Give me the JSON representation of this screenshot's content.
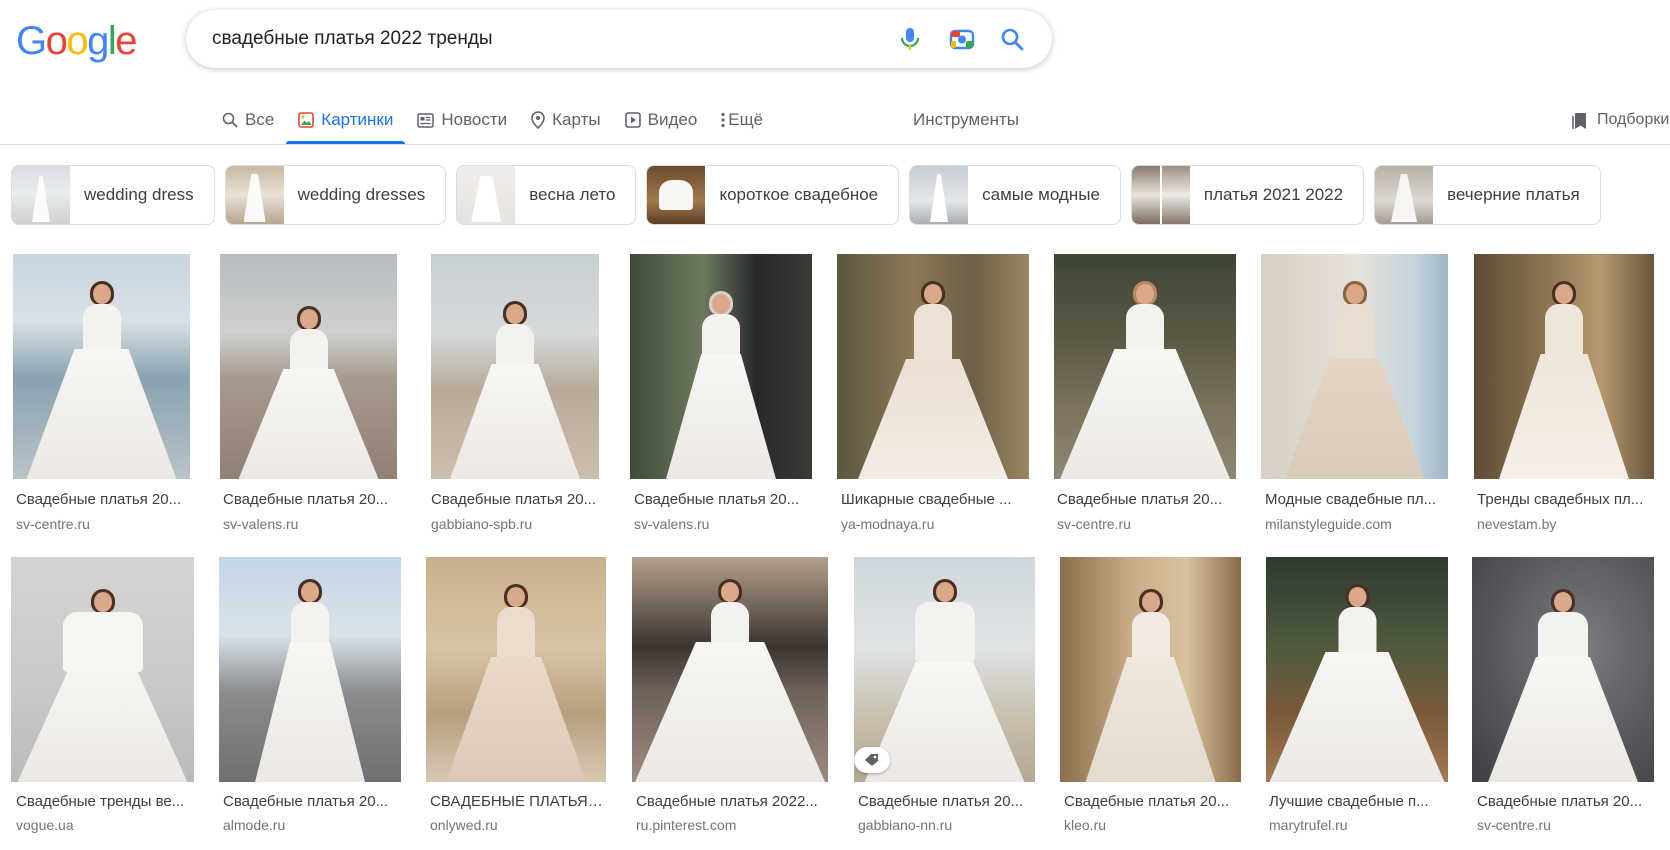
{
  "logo": {
    "text": "Google",
    "letters": [
      "G",
      "o",
      "o",
      "g",
      "l",
      "e"
    ],
    "colors": [
      "#4285F4",
      "#EA4335",
      "#FBBC05",
      "#4285F4",
      "#34A853",
      "#EA4335"
    ]
  },
  "search": {
    "query": "свадебные платья 2022 тренды"
  },
  "tabs": [
    {
      "label": "Все",
      "icon": "search-icon",
      "active": false
    },
    {
      "label": "Картинки",
      "icon": "image-icon",
      "active": true
    },
    {
      "label": "Новости",
      "icon": "news-icon",
      "active": false
    },
    {
      "label": "Карты",
      "icon": "map-pin-icon",
      "active": false
    },
    {
      "label": "Видео",
      "icon": "video-icon",
      "active": false
    },
    {
      "label": "Ещё",
      "icon": "more-vert-icon",
      "active": false
    }
  ],
  "tools_label": "Инструменты",
  "collections_label": "Подборки",
  "chips": [
    {
      "label": "wedding dress"
    },
    {
      "label": "wedding dresses"
    },
    {
      "label": "весна лето"
    },
    {
      "label": "короткое свадебное"
    },
    {
      "label": "самые модные"
    },
    {
      "label": "платья 2021 2022"
    },
    {
      "label": "вечерние платья"
    }
  ],
  "results": [
    [
      {
        "title": "Свадебные платья 20...",
        "source": "sv-centre.ru"
      },
      {
        "title": "Свадебные платья 20...",
        "source": "sv-valens.ru"
      },
      {
        "title": "Свадебные платья 20...",
        "source": "gabbiano-spb.ru"
      },
      {
        "title": "Свадебные платья 20...",
        "source": "sv-valens.ru"
      },
      {
        "title": "Шикарные свадебные ...",
        "source": "ya-modnaya.ru"
      },
      {
        "title": "Свадебные платья 20...",
        "source": "sv-centre.ru"
      },
      {
        "title": "Модные свадебные пл...",
        "source": "milanstyleguide.com"
      },
      {
        "title": "Тренды свадебных пл...",
        "source": "nevestam.by"
      }
    ],
    [
      {
        "title": "Свадебные тренды ве...",
        "source": "vogue.ua"
      },
      {
        "title": "Свадебные платья 20...",
        "source": "almode.ru"
      },
      {
        "title": "СВАДЕБНЫЕ ПЛАТЬЯ ...",
        "source": "onlywed.ru"
      },
      {
        "title": "Свадебные платья 2022...",
        "source": "ru.pinterest.com"
      },
      {
        "title": "Свадебные платья 20...",
        "source": "gabbiano-nn.ru"
      },
      {
        "title": "Свадебные платья 20...",
        "source": "kleo.ru"
      },
      {
        "title": "Лучшие свадебные п...",
        "source": "marytrufel.ru"
      },
      {
        "title": "Свадебные платья 20...",
        "source": "sv-centre.ru"
      }
    ]
  ]
}
